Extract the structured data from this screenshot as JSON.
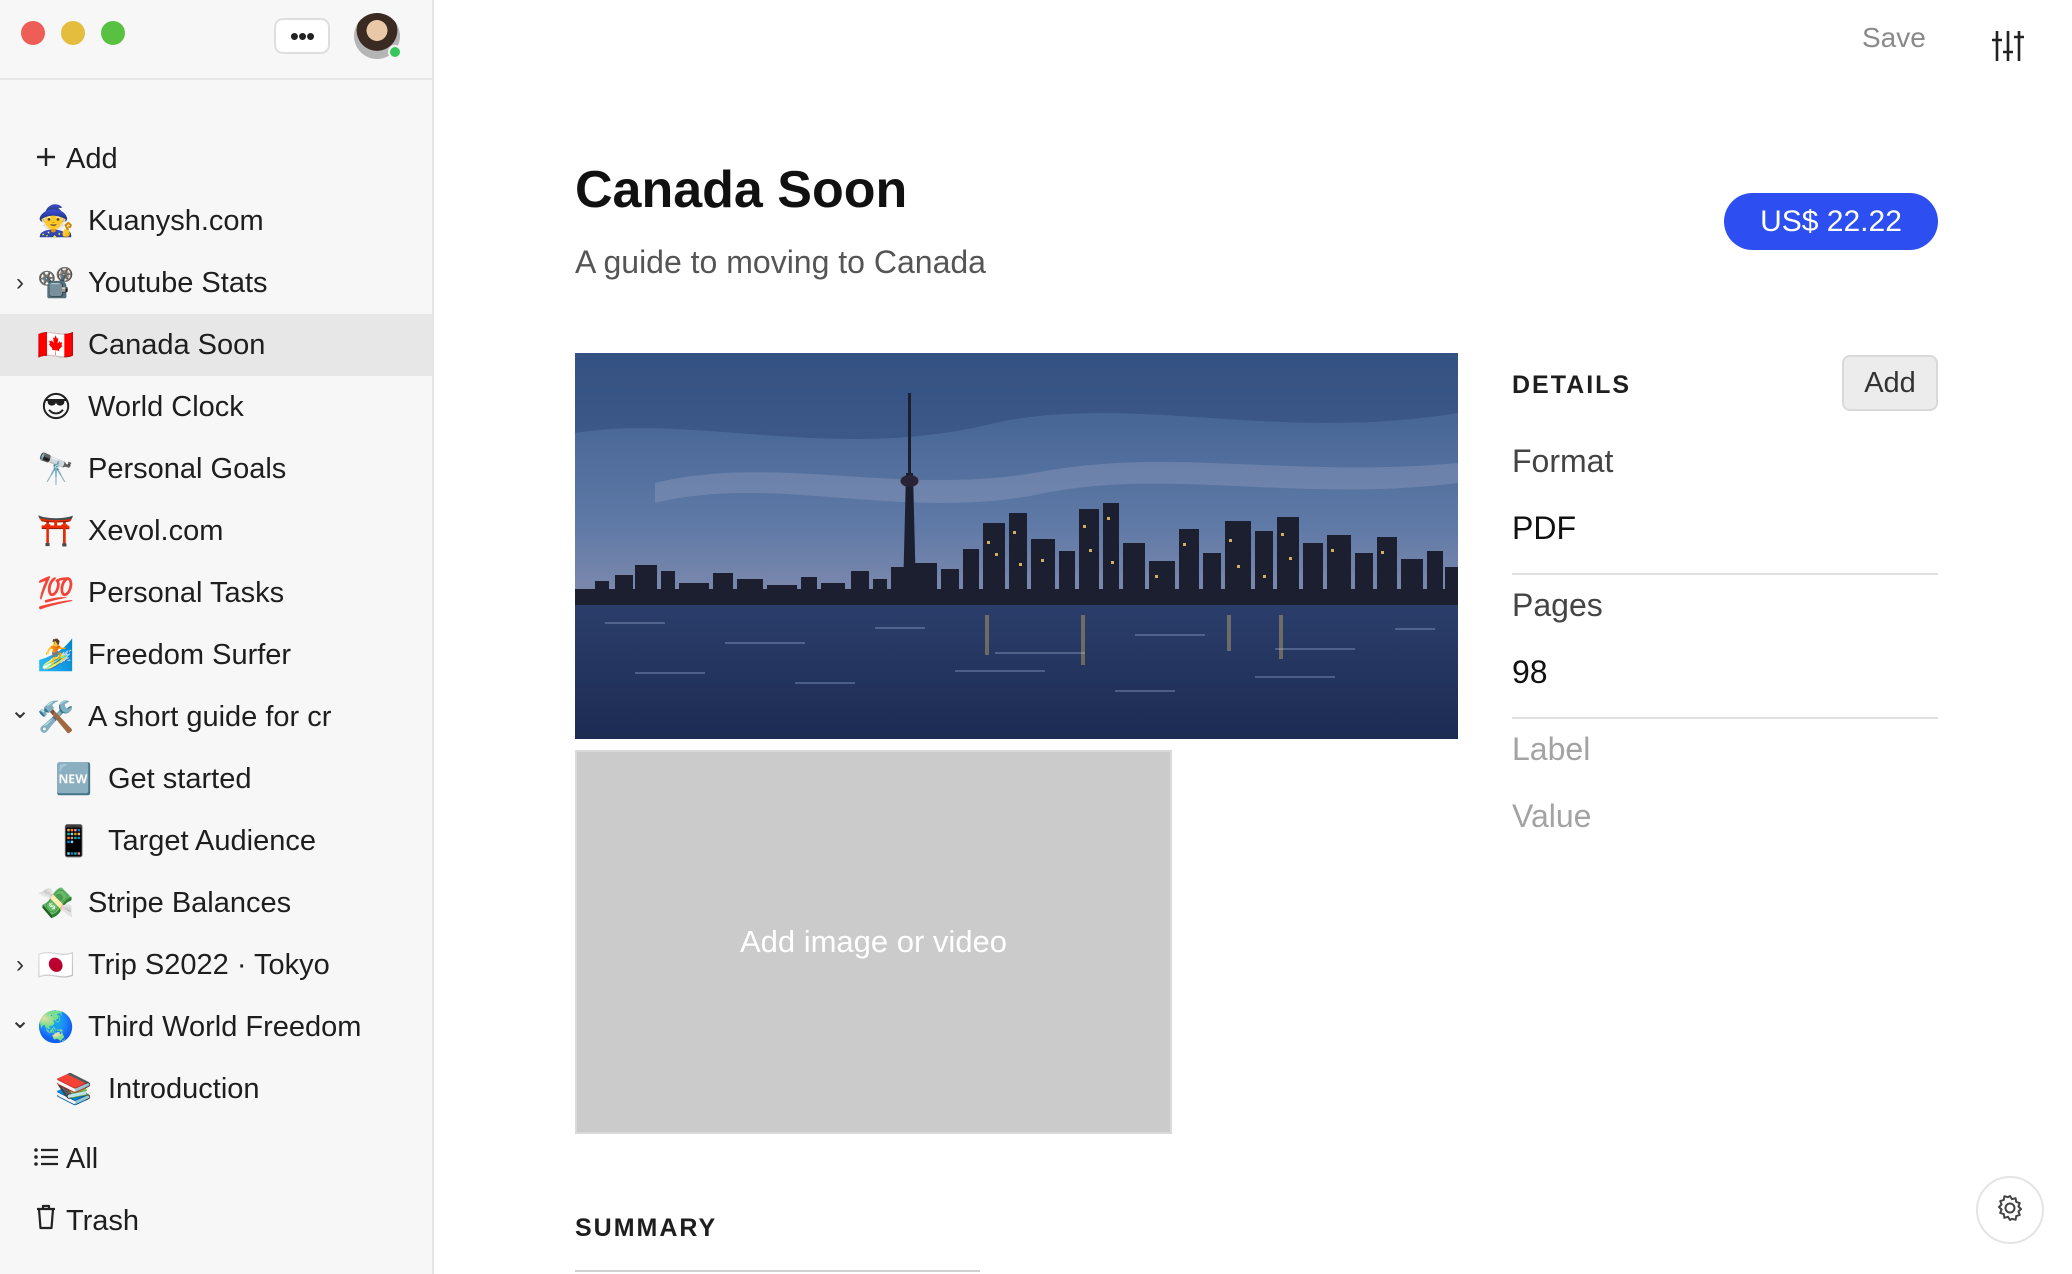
{
  "window": {
    "more_label": "•••"
  },
  "toolbar": {
    "save_label": "Save"
  },
  "sidebar": {
    "add_label": "Add",
    "items": [
      {
        "emoji": "🧙",
        "label": "Kuanysh.com",
        "chevron": "",
        "active": false
      },
      {
        "emoji": "📽️",
        "label": "Youtube Stats",
        "chevron": "›",
        "active": false
      },
      {
        "emoji": "🇨🇦",
        "label": "Canada Soon",
        "chevron": "",
        "active": true
      },
      {
        "emoji": "😎",
        "label": "World Clock",
        "chevron": "",
        "active": false
      },
      {
        "emoji": "🔭",
        "label": "Personal Goals",
        "chevron": "",
        "active": false
      },
      {
        "emoji": "⛩️",
        "label": "Xevol.com",
        "chevron": "",
        "active": false
      },
      {
        "emoji": "💯",
        "label": "Personal Tasks",
        "chevron": "",
        "active": false
      },
      {
        "emoji": "🏄",
        "label": "Freedom Surfer",
        "chevron": "",
        "active": false
      },
      {
        "emoji": "🛠️",
        "label": "A short guide for cr",
        "chevron": "⌄",
        "active": false
      },
      {
        "emoji": "🆕",
        "label": "Get started",
        "chevron": "",
        "active": false,
        "child": true
      },
      {
        "emoji": "📱",
        "label": "Target Audience",
        "chevron": "",
        "active": false,
        "child": true
      },
      {
        "emoji": "💸",
        "label": "Stripe Balances",
        "chevron": "",
        "active": false
      },
      {
        "emoji": "🇯🇵",
        "label": "Trip S2022 · Tokyo",
        "chevron": "›",
        "active": false
      },
      {
        "emoji": "🌏",
        "label": "Third World Freedom",
        "chevron": "⌄",
        "active": false
      },
      {
        "emoji": "📚",
        "label": "Introduction",
        "chevron": "",
        "active": false,
        "child": true
      }
    ],
    "all_label": "All",
    "trash_label": "Trash"
  },
  "product": {
    "title": "Canada Soon",
    "subtitle": "A guide to moving to Canada",
    "price": "US$ 22.22",
    "add_media_label": "Add image or video"
  },
  "details": {
    "heading": "DETAILS",
    "add_label": "Add",
    "fields": [
      {
        "key": "Format",
        "value": "PDF"
      },
      {
        "key": "Pages",
        "value": "98"
      }
    ],
    "placeholder": {
      "key": "Label",
      "value": "Value"
    }
  },
  "summary": {
    "heading": "SUMMARY"
  },
  "icons": {
    "add": "plus-icon",
    "all": "list-icon",
    "trash": "trash-icon",
    "settings": "sliders-icon",
    "gear": "gear-icon"
  },
  "colors": {
    "accent": "#2d4ef0",
    "sidebar_bg": "#f7f7f7",
    "active_item_bg": "#e7e7e7"
  }
}
